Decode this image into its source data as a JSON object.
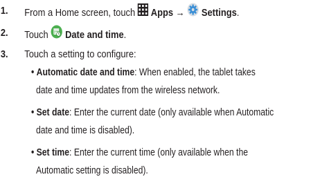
{
  "steps": [
    {
      "number": "1.",
      "text_before": "From a Home screen, touch ",
      "apps_label": "Apps",
      "arrow": "→",
      "settings_label": "Settings",
      "end": "."
    },
    {
      "number": "2.",
      "text_before": "Touch ",
      "item_label": "Date and time",
      "end": "."
    },
    {
      "number": "3.",
      "text": "Touch a setting to configure:"
    }
  ],
  "bullets": [
    {
      "term": "Automatic date and time",
      "line1": ": When enabled, the tablet takes",
      "line2": "date and time updates from the wireless network."
    },
    {
      "term": "Set date",
      "line1": ": Enter the current date (only available when Automatic",
      "line2": "date and time is disabled)."
    },
    {
      "term": "Set time",
      "line1": ": Enter the current time (only available when the",
      "line2": "Automatic setting is disabled)."
    }
  ],
  "icons": {
    "apps": "apps-grid-icon",
    "settings": "settings-gear-icon",
    "date_time": "date-and-time-icon"
  },
  "colors": {
    "text": "#231f20",
    "date_icon_green": "#4caf50",
    "settings_icon_blue": "#3a8fd6"
  }
}
